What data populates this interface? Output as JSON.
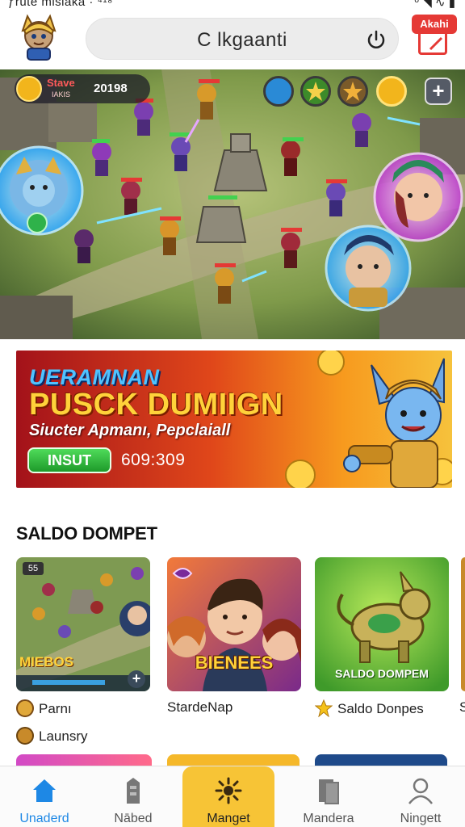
{
  "status_bar": {
    "left_text": "ƒrute misiaka ·  ⁴¹⁸",
    "right_text": "⁰ ◥ ∿ ▮"
  },
  "header": {
    "search_text": "C lkgaanti",
    "badge_text": "Akahi"
  },
  "hud": {
    "name": "Stave",
    "subtitle": "IAKIS",
    "score": "20198"
  },
  "promo": {
    "line1": "UERAMNAN",
    "line2": "PUSCK DUMIIGN",
    "line3": "Siucter Apmanı, Pepclaiall",
    "button": "INSUT",
    "code": "609:309"
  },
  "section": {
    "title": "SALDO DOMPET",
    "cards": [
      {
        "caption": "Parnı",
        "art_text": "MIEBOS",
        "corner_text": "55"
      },
      {
        "caption": "StardeNap",
        "art_text": "BIENEES"
      },
      {
        "caption": "Saldo Donpes",
        "art_text": "SALDO DOMPEM"
      }
    ],
    "extra_caption": "Launsry"
  },
  "nav": [
    {
      "label": "Unaderd",
      "icon": "home-icon",
      "active": true
    },
    {
      "label": "Nābed",
      "icon": "building-icon"
    },
    {
      "label": "Manget",
      "icon": "burst-icon"
    },
    {
      "label": "Mandera",
      "icon": "cards-icon"
    },
    {
      "label": "Ningett",
      "icon": "person-icon"
    }
  ],
  "colors": {
    "accent": "#1e88e5",
    "nav_center": "#f7c436",
    "badge": "#e53935",
    "promo_button": "#2ea83a"
  }
}
